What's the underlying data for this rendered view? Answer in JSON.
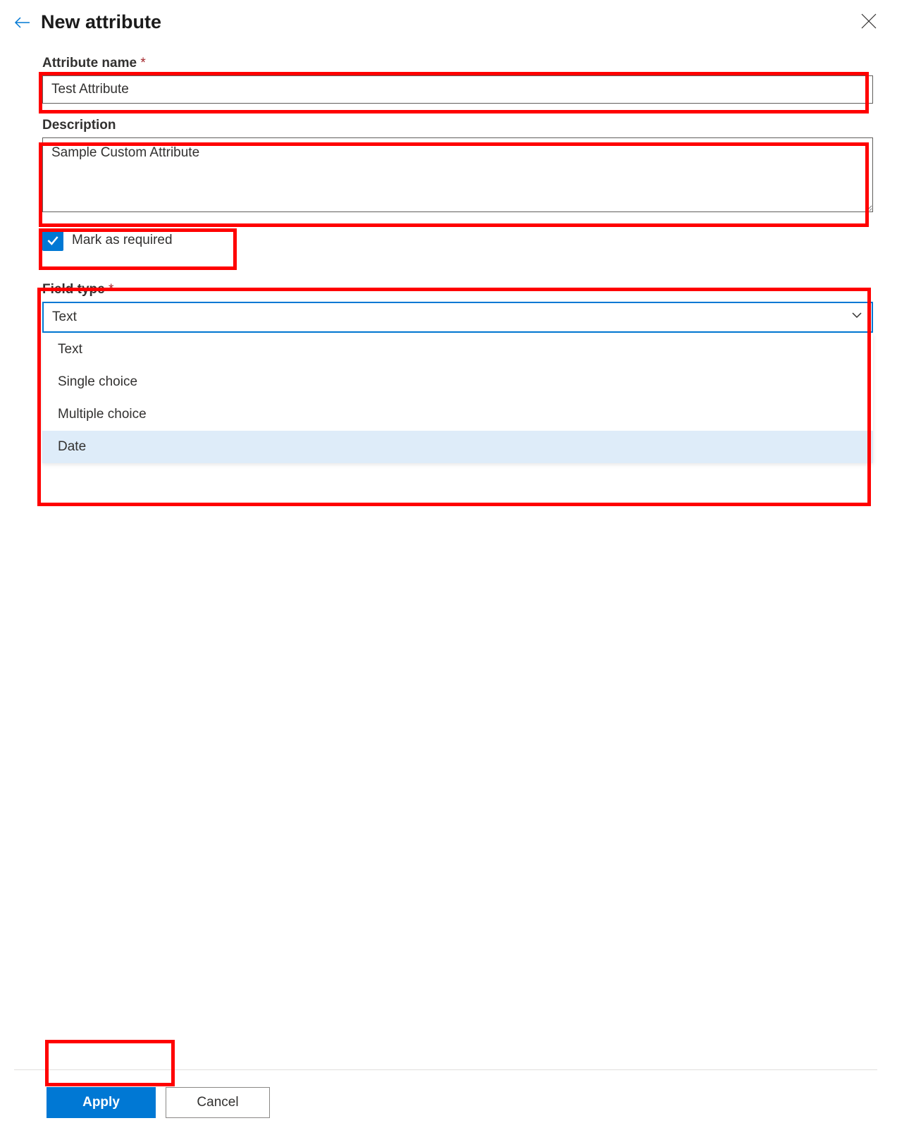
{
  "header": {
    "title": "New attribute"
  },
  "form": {
    "attribute_name": {
      "label": "Attribute name",
      "value": "Test Attribute",
      "required": true
    },
    "description": {
      "label": "Description",
      "value": "Sample Custom Attribute"
    },
    "mark_required": {
      "label": "Mark as required",
      "checked": true
    },
    "field_type": {
      "label": "Field type",
      "required": true,
      "selected": "Text",
      "options": [
        "Text",
        "Single choice",
        "Multiple choice",
        "Date"
      ],
      "hovered_index": 3
    }
  },
  "footer": {
    "apply": "Apply",
    "cancel": "Cancel"
  }
}
